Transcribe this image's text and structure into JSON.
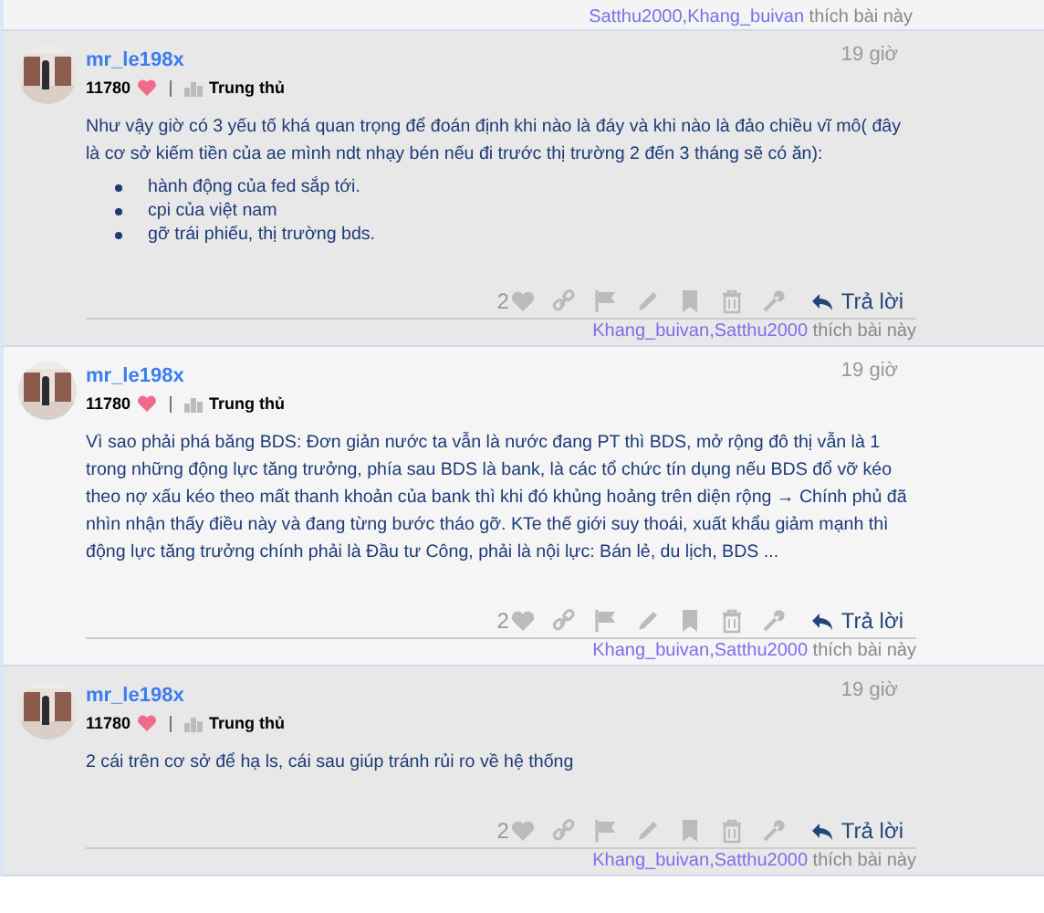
{
  "previous_post_likes": {
    "names": [
      "Satthu2000",
      "Khang_buivan"
    ],
    "separator": ",",
    "suffix": "thích bài này"
  },
  "posts": [
    {
      "author": "mr_le198x",
      "score": "11780",
      "rank": "Trung thủ",
      "time": "19 giờ",
      "highlighted": true,
      "body": [
        {
          "kind": "paragraph",
          "text": "Như vậy giờ có 3 yếu tố khá quan trọng để đoán định khi nào là đáy và khi nào là đảo chiều vĩ mô( đây là cơ sở kiếm tiền của ae mình ndt nhạy bén nếu đi trước thị trường 2 đến 3 tháng sẽ có ăn):"
        },
        {
          "kind": "list",
          "items": [
            "hành động của fed sắp tới.",
            "cpi của việt nam",
            "gỡ trái phiếu, thị trường bds."
          ]
        }
      ],
      "like_count": "2",
      "reply": "Trả lời",
      "likes": {
        "names": [
          "Khang_buivan",
          "Satthu2000"
        ],
        "separator": ",",
        "suffix": "thích bài này"
      }
    },
    {
      "author": "mr_le198x",
      "score": "11780",
      "rank": "Trung thủ",
      "time": "19 giờ",
      "highlighted": false,
      "body": [
        {
          "kind": "paragraph",
          "text": "Vì sao phải phá băng BDS: Đơn giản nước ta vẫn là nước đang PT thì BDS, mở rộng đô thị vẫn là 1 trong những động lực tăng trưởng, phía sau BDS là bank, là các tổ chức tín dụng nếu BDS đổ vỡ kéo theo nợ xấu kéo theo mất thanh khoản của bank thì khi đó khủng hoảng trên diện rộng → Chính phủ đã nhìn nhận thấy điều này và đang từng bước tháo gỡ. KTe thế giới suy thoái, xuất khẩu giảm mạnh thì động lực tăng trưởng chính phải là Đầu tư Công, phải là nội lực: Bán lẻ, du lịch, BDS ..."
        }
      ],
      "like_count": "2",
      "reply": "Trả lời",
      "likes": {
        "names": [
          "Khang_buivan",
          "Satthu2000"
        ],
        "separator": ",",
        "suffix": "thích bài này"
      }
    },
    {
      "author": "mr_le198x",
      "score": "11780",
      "rank": "Trung thủ",
      "time": "19 giờ",
      "highlighted": true,
      "body": [
        {
          "kind": "paragraph",
          "text": "2 cái trên cơ sở để hạ ls, cái sau giúp tránh rủi ro về hệ thống"
        }
      ],
      "like_count": "2",
      "reply": "Trả lời",
      "likes": {
        "names": [
          "Khang_buivan",
          "Satthu2000"
        ],
        "separator": ",",
        "suffix": "thích bài này"
      }
    }
  ]
}
